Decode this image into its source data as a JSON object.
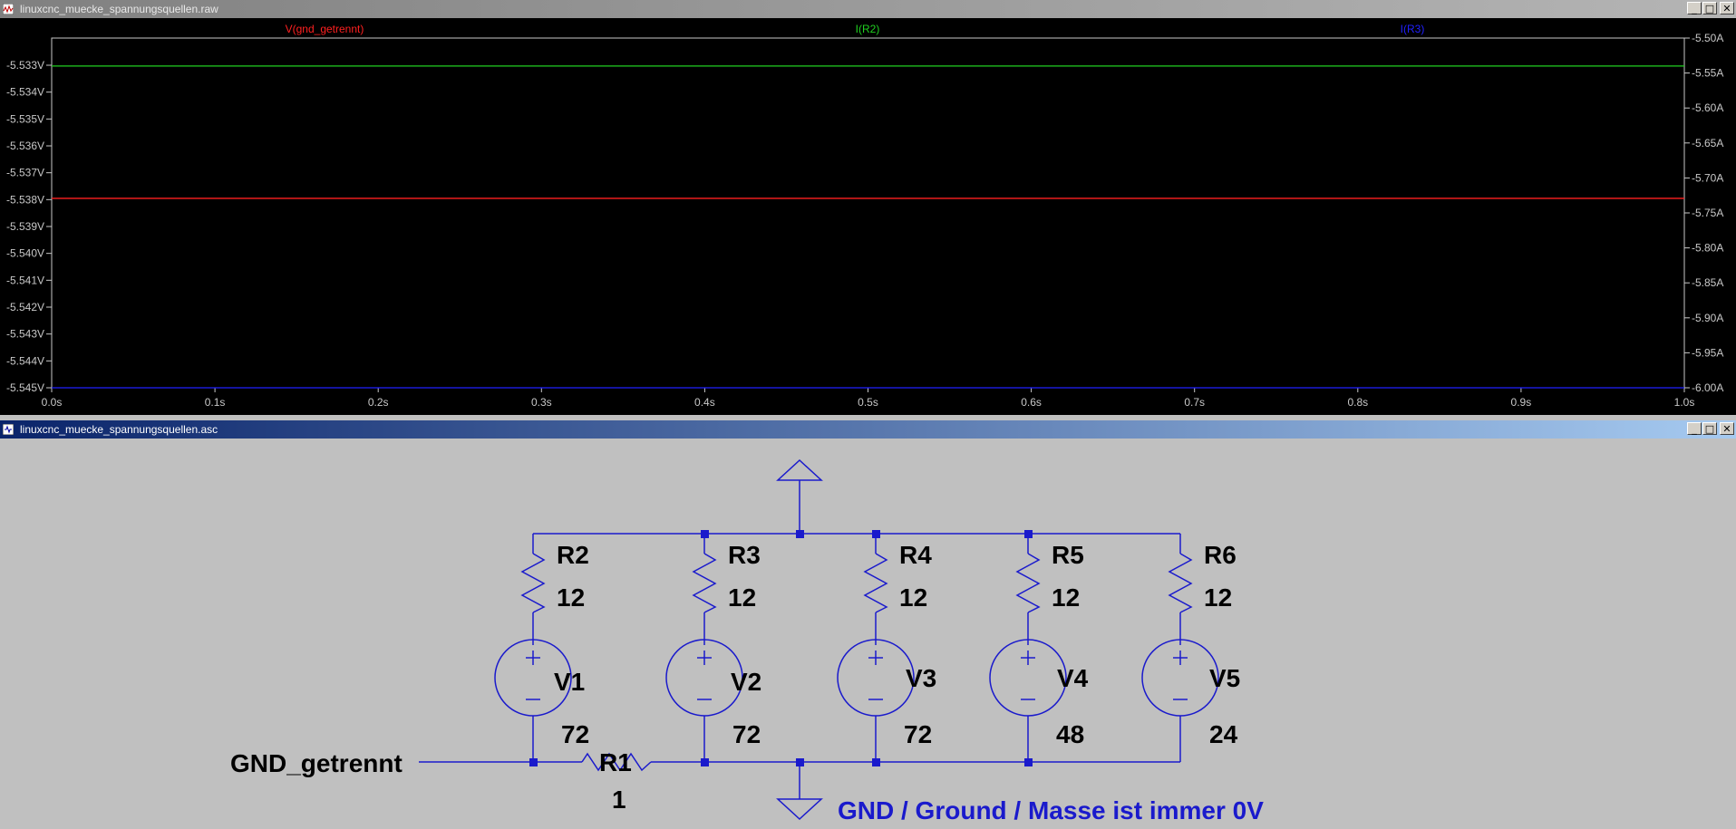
{
  "waveform_window": {
    "title": "linuxcnc_muecke_spannungsquellen.raw",
    "buttons": {
      "minimize": "_",
      "maximize": "□",
      "close": "✕"
    },
    "background": "#000000",
    "traces": [
      {
        "label": "V(gnd_getrennt)",
        "color": "#ff2020"
      },
      {
        "label": "I(R2)",
        "color": "#20d020"
      },
      {
        "label": "I(R3)",
        "color": "#2020ff"
      }
    ],
    "left_axis_ticks": [
      "-5.533V",
      "-5.534V",
      "-5.535V",
      "-5.536V",
      "-5.537V",
      "-5.538V",
      "-5.539V",
      "-5.540V",
      "-5.541V",
      "-5.542V",
      "-5.543V",
      "-5.544V",
      "-5.545V"
    ],
    "right_axis_ticks": [
      "-5.50A",
      "-5.55A",
      "-5.60A",
      "-5.65A",
      "-5.70A",
      "-5.75A",
      "-5.80A",
      "-5.85A",
      "-5.90A",
      "-5.95A",
      "-6.00A"
    ],
    "x_axis_ticks": [
      "0.0s",
      "0.1s",
      "0.2s",
      "0.3s",
      "0.4s",
      "0.5s",
      "0.6s",
      "0.7s",
      "0.8s",
      "0.9s",
      "1.0s"
    ]
  },
  "chart_data": {
    "type": "line",
    "x": [
      0.0,
      1.0
    ],
    "xlim": [
      0.0,
      1.0
    ],
    "ylim_left": [
      -5.545,
      -5.533
    ],
    "ylim_right": [
      -6.0,
      -5.5
    ],
    "series": [
      {
        "name": "V(gnd_getrennt)",
        "axis": "left",
        "unit": "V",
        "values": [
          -5.5385,
          -5.5385
        ],
        "color": "#ff2020"
      },
      {
        "name": "I(R2)",
        "axis": "right",
        "unit": "A",
        "values": [
          -5.54,
          -5.54
        ],
        "color": "#20d020"
      },
      {
        "name": "I(R3)",
        "axis": "right",
        "unit": "A",
        "values": [
          -6.0,
          -6.0
        ],
        "color": "#2020ff"
      }
    ],
    "grid": false
  },
  "schematic_window": {
    "title": "linuxcnc_muecke_spannungsquellen.asc",
    "buttons": {
      "minimize": "_",
      "maximize": "□",
      "close": "✕"
    },
    "wire_color": "#1a1acc",
    "components": [
      {
        "ref": "R2",
        "value": "12"
      },
      {
        "ref": "R3",
        "value": "12"
      },
      {
        "ref": "R4",
        "value": "12"
      },
      {
        "ref": "R5",
        "value": "12"
      },
      {
        "ref": "R6",
        "value": "12"
      },
      {
        "ref": "V1",
        "value": "72"
      },
      {
        "ref": "V2",
        "value": "72"
      },
      {
        "ref": "V3",
        "value": "72"
      },
      {
        "ref": "V4",
        "value": "48"
      },
      {
        "ref": "V5",
        "value": "24"
      },
      {
        "ref": "R1",
        "value": "1"
      }
    ],
    "net_label": "GND_getrennt",
    "comment": "GND / Ground / Masse ist immer 0V"
  }
}
